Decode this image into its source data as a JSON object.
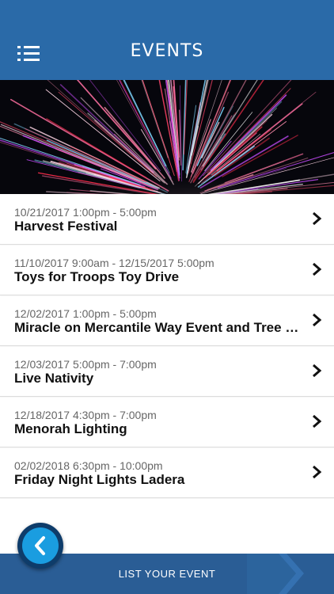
{
  "header": {
    "title": "EVENTS",
    "menu_icon": "hamburger-list-icon"
  },
  "hero": {
    "image": "fireworks"
  },
  "events": [
    {
      "date": "10/21/2017 1:00pm - 5:00pm",
      "name": "Harvest Festival"
    },
    {
      "date": "11/10/2017 9:00am - 12/15/2017 5:00pm",
      "name": "Toys for Troops Toy Drive"
    },
    {
      "date": "12/02/2017 1:00pm - 5:00pm",
      "name": "Miracle on Mercantile Way Event and Tree L..."
    },
    {
      "date": "12/03/2017 5:00pm - 7:00pm",
      "name": "Live Nativity"
    },
    {
      "date": "12/18/2017 4:30pm - 7:00pm",
      "name": "Menorah Lighting"
    },
    {
      "date": "02/02/2018 6:30pm - 10:00pm",
      "name": "Friday Night Lights Ladera"
    }
  ],
  "footer": {
    "label": "LIST YOUR EVENT"
  },
  "colors": {
    "header": "#2a6aa8",
    "footer": "#2a5d95",
    "back_button": "#1a9de0"
  }
}
